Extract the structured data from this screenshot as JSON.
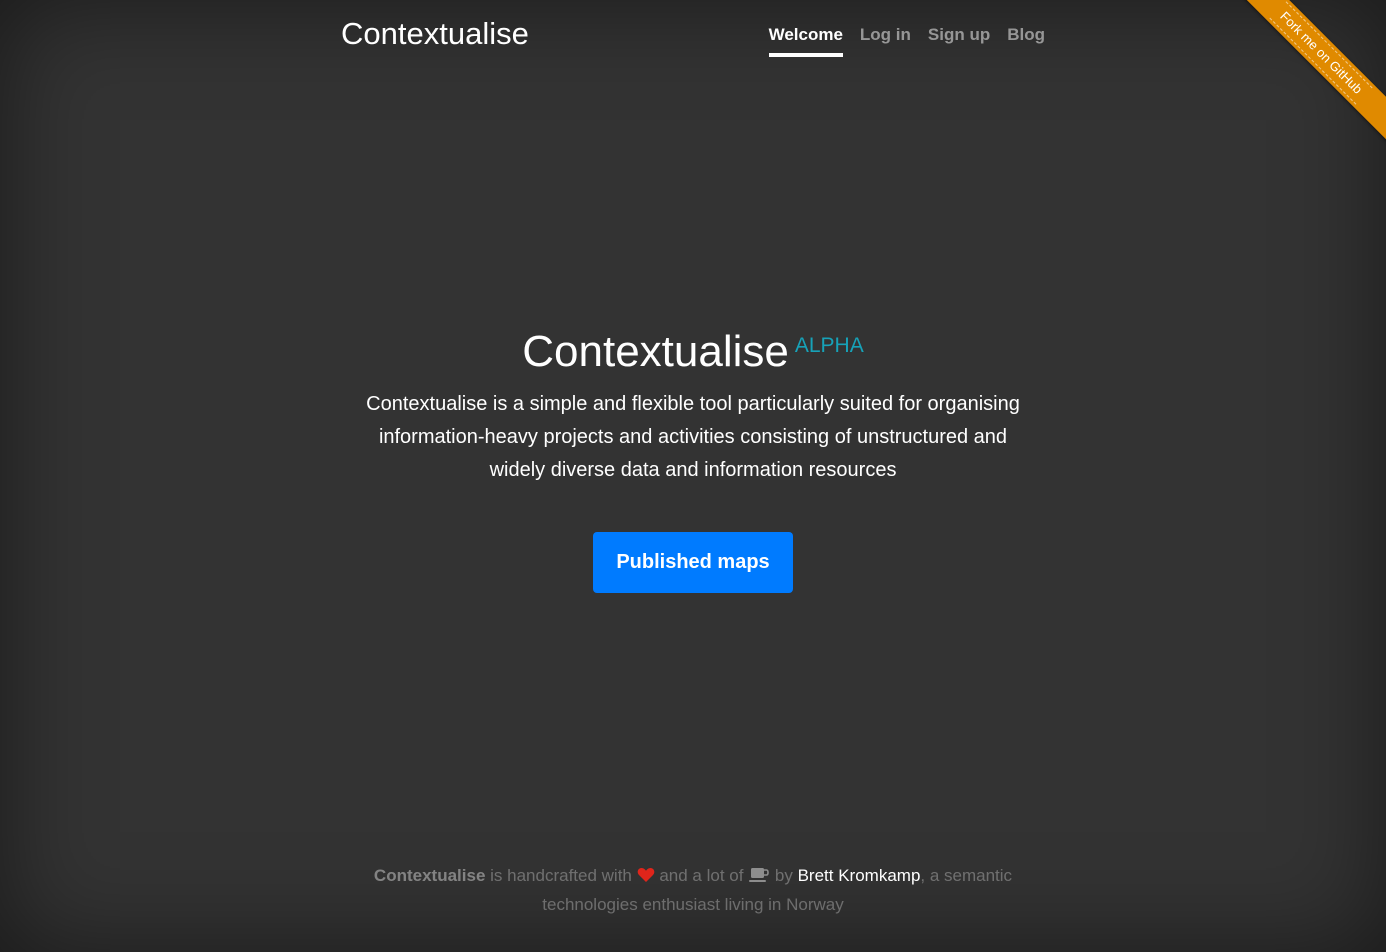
{
  "header": {
    "brand": "Contextualise",
    "nav": [
      {
        "label": "Welcome",
        "active": true
      },
      {
        "label": "Log in",
        "active": false
      },
      {
        "label": "Sign up",
        "active": false
      },
      {
        "label": "Blog",
        "active": false
      }
    ]
  },
  "ribbon": {
    "label": "Fork me on GitHub",
    "color": "#e08a00"
  },
  "hero": {
    "title": "Contextualise",
    "badge": "ALPHA",
    "badge_color": "#17a2b8",
    "lead": "Contextualise is a simple and flexible tool particularly suited for organising information-heavy projects and activities consisting of unstructured and widely diverse data and information resources",
    "button_label": "Published maps",
    "button_color": "#007bff"
  },
  "footer": {
    "brand": "Contextualise",
    "text_1": " is handcrafted with ",
    "heart_icon": "heart-icon",
    "text_2": " and a lot of ",
    "coffee_icon": "coffee-icon",
    "text_3": " by ",
    "author": "Brett Kromkamp",
    "text_4": ", a semantic technologies enthusiast living in Norway"
  }
}
